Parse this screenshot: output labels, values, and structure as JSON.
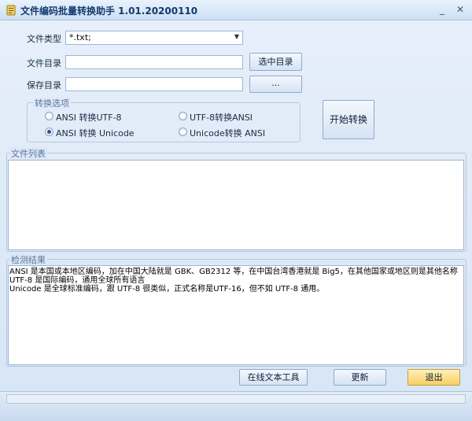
{
  "window": {
    "title": "文件编码批量转换助手 1.01.20200110",
    "minimize": "_",
    "close": "✕"
  },
  "form": {
    "file_type_label": "文件类型",
    "file_type_value": "*.txt;",
    "file_dir_label": "文件目录",
    "file_dir_value": "",
    "select_dir_button": "选中目录",
    "save_dir_label": "保存目录",
    "save_dir_value": "",
    "browse_button": "..."
  },
  "options": {
    "legend": "转换选项",
    "items": [
      {
        "label": "ANSI 转换UTF-8",
        "selected": false
      },
      {
        "label": "UTF-8转换ANSI",
        "selected": false
      },
      {
        "label": "ANSI 转换 Unicode",
        "selected": true
      },
      {
        "label": "Unicode转换 ANSI",
        "selected": false
      }
    ],
    "start_button": "开始转换"
  },
  "file_list": {
    "legend": "文件列表"
  },
  "results": {
    "legend": "检测结果",
    "lines": [
      "ANSI 是本国或本地区编码，加在中国大陆就是 GBK、GB2312 等，在中国台湾香港就是 Big5，在其他国家或地区则是其他名称",
      "UTF-8 是国际编码，通用全球所有语言",
      "Unicode 是全球标准编码，跟 UTF-8 很类似，正式名称是UTF-16，但不如 UTF-8 通用。"
    ]
  },
  "bottom": {
    "online_tool_button": "在线文本工具",
    "update_button": "更新",
    "exit_button": "退出"
  },
  "colors": {
    "exit_button": "#f7cf63"
  }
}
